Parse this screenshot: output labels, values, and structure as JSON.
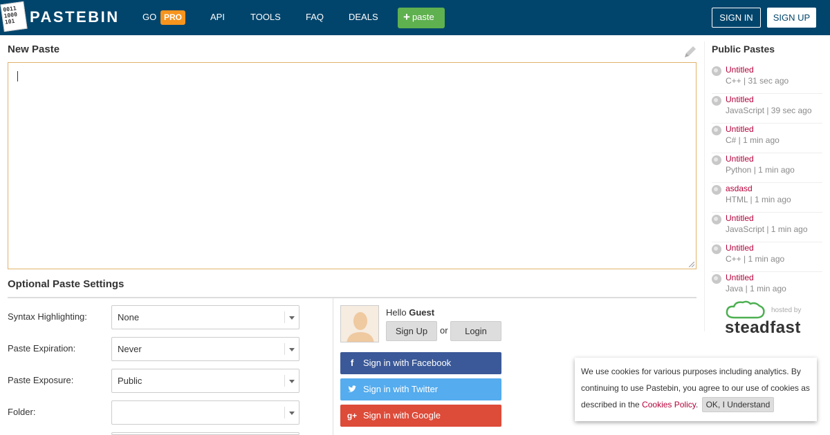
{
  "header": {
    "logo_icon_lines": [
      "0011",
      "1000",
      "101"
    ],
    "logo_text": "PASTEBIN",
    "nav": {
      "go": "GO",
      "pro": "PRO",
      "api": "API",
      "tools": "TOOLS",
      "faq": "FAQ",
      "deals": "DEALS"
    },
    "paste_button": "paste",
    "sign_in": "SIGN IN",
    "sign_up": "SIGN UP"
  },
  "editor": {
    "title": "New Paste",
    "value": ""
  },
  "settings": {
    "title": "Optional Paste Settings",
    "syntax": {
      "label": "Syntax Highlighting:",
      "value": "None"
    },
    "expiration": {
      "label": "Paste Expiration:",
      "value": "Never"
    },
    "exposure": {
      "label": "Paste Exposure:",
      "value": "Public"
    },
    "folder": {
      "label": "Folder:",
      "value": ""
    }
  },
  "guest": {
    "hello": "Hello",
    "name": "Guest",
    "sign_up": "Sign Up",
    "or": "or",
    "login": "Login",
    "facebook": "Sign in with Facebook",
    "twitter": "Sign in with Twitter",
    "google": "Sign in with Google"
  },
  "sidebar": {
    "title": "Public Pastes",
    "items": [
      {
        "title": "Untitled",
        "meta": "C++ | 31 sec ago"
      },
      {
        "title": "Untitled",
        "meta": "JavaScript | 39 sec ago"
      },
      {
        "title": "Untitled",
        "meta": "C# | 1 min ago"
      },
      {
        "title": "Untitled",
        "meta": "Python | 1 min ago"
      },
      {
        "title": "asdasd",
        "meta": "HTML | 1 min ago"
      },
      {
        "title": "Untitled",
        "meta": "JavaScript | 1 min ago"
      },
      {
        "title": "Untitled",
        "meta": "C++ | 1 min ago"
      },
      {
        "title": "Untitled",
        "meta": "Java | 1 min ago"
      }
    ],
    "hosted_by": "hosted by",
    "host_name": "steadfast"
  },
  "cookie": {
    "text": "We use cookies for various purposes including analytics. By continuing to use Pastebin, you agree to our use of cookies as described in the ",
    "link": "Cookies Policy",
    "after": ".",
    "button": "OK, I Understand"
  },
  "colors": {
    "header_bg": "#02456c",
    "pro_badge": "#f7941d",
    "paste_button": "#5fb04f",
    "link_red": "#b5003a",
    "facebook": "#3b5998",
    "twitter": "#55acee",
    "google": "#dd4b39"
  }
}
